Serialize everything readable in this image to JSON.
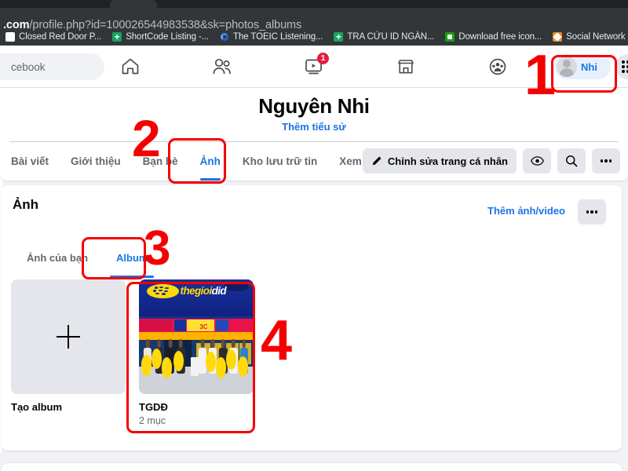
{
  "browser": {
    "url_domain": ".com",
    "url_rest": "/profile.php?id=100026544983538&sk=photos_albums",
    "bookmarks": [
      {
        "label": "Closed Red Door P...",
        "icon": "white-square-icon"
      },
      {
        "label": "ShortCode Listing -...",
        "icon": "green-cross-icon"
      },
      {
        "label": "The TOEIC Listening...",
        "icon": "blue-ring-icon"
      },
      {
        "label": "TRA CỨU ID NGÀN...",
        "icon": "green-cross-icon"
      },
      {
        "label": "Download free icon...",
        "icon": "green-square-icon"
      },
      {
        "label": "Social Network for...",
        "icon": "orange-hex-icon"
      }
    ]
  },
  "topnav": {
    "search_placeholder": "cebook",
    "icons": [
      {
        "name": "home-icon",
        "badge": ""
      },
      {
        "name": "friends-icon",
        "badge": ""
      },
      {
        "name": "video-icon",
        "badge": "1"
      },
      {
        "name": "marketplace-icon",
        "badge": ""
      },
      {
        "name": "groups-icon",
        "badge": ""
      }
    ],
    "account_name": "Nhi",
    "grid_menu": "grid-menu-icon"
  },
  "profile": {
    "name": "Nguyên Nhi",
    "bio_link": "Thêm tiểu sử",
    "tabs": [
      {
        "label": "Bài viết",
        "active": false
      },
      {
        "label": "Giới thiệu",
        "active": false
      },
      {
        "label": "Bạn bè",
        "active": false
      },
      {
        "label": "Ảnh",
        "active": true
      },
      {
        "label": "Kho lưu trữ tin",
        "active": false
      },
      {
        "label": "Xem thêm",
        "active": false,
        "caret": true
      }
    ],
    "edit_button": "Chỉnh sửa trang cá nhân",
    "view_button": "eye-icon",
    "search_button": "search-icon",
    "more_button": "ellipsis-icon"
  },
  "photos": {
    "title": "Ảnh",
    "add_link": "Thêm ảnh/video",
    "more_button": "ellipsis-icon",
    "subtabs": [
      {
        "label": "Ảnh của bạn",
        "active": false
      },
      {
        "label": "Album",
        "active": true
      }
    ],
    "albums": [
      {
        "name": "Tạo album",
        "count": "",
        "type": "create"
      },
      {
        "name": "TGDĐ",
        "count": "2 mục",
        "type": "album",
        "thumb_brand": "thegioi",
        "thumb_brand_suffix": "did"
      }
    ]
  },
  "annotations": [
    {
      "number": "1",
      "target": "account-pill"
    },
    {
      "number": "2",
      "target": "photos-tab"
    },
    {
      "number": "3",
      "target": "album-subtab"
    },
    {
      "number": "4",
      "target": "album-card"
    }
  ],
  "colors": {
    "accent_blue": "#1b74e4",
    "annotation_red": "#f50000",
    "chrome_dark": "#323639",
    "page_bg": "#f0f2f5"
  }
}
